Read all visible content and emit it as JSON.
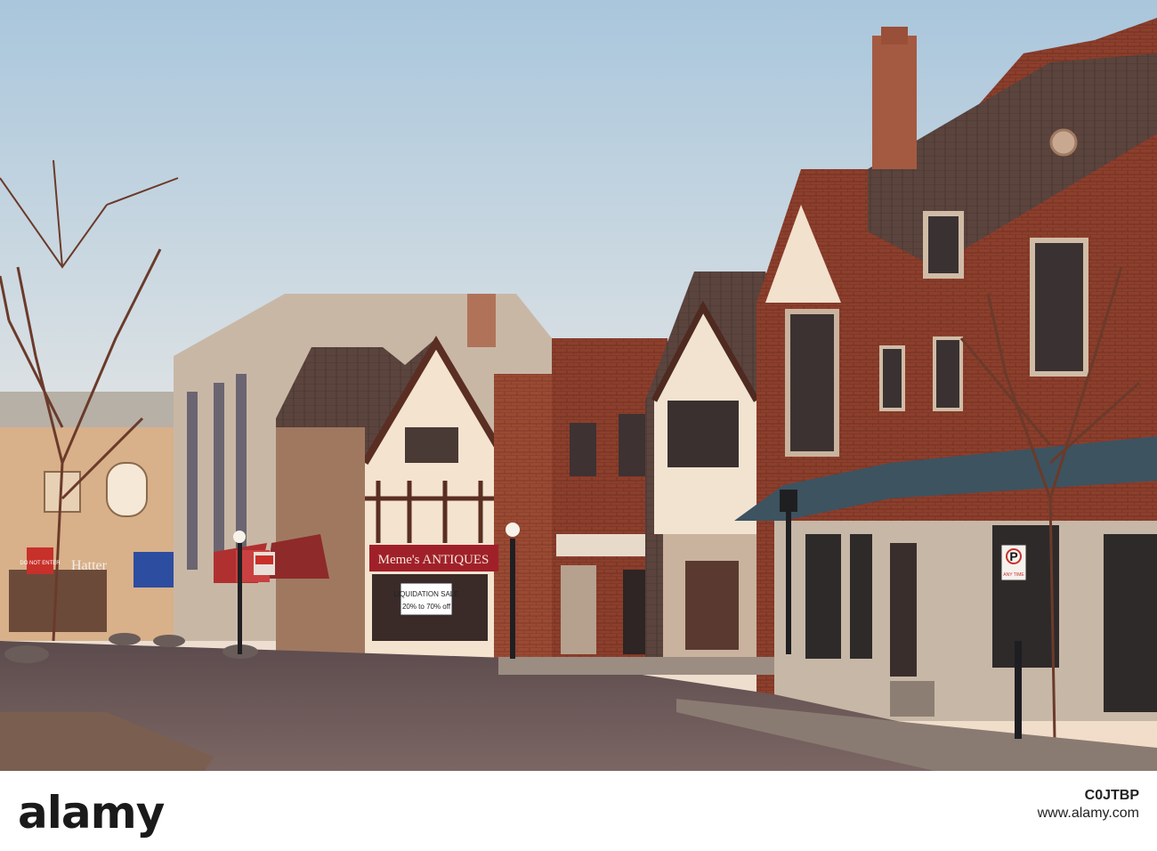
{
  "photo": {
    "description_free": true,
    "signs": {
      "memes": "Meme's ANTIQUES",
      "liquidation": "LIQUIDATION SALE",
      "discount": "20% to 70% off",
      "do_not_enter": "DO NOT ENTER",
      "hatter": "Hatter",
      "no_parking": "P",
      "any_time": "ANY TIME"
    },
    "colors": {
      "sky_top": "#a9c6dc",
      "sky_bottom": "#f5e6d6",
      "brick": "#8a3f2e",
      "street": "#6c5a58",
      "awning": "#a0202a"
    }
  },
  "watermark": {
    "logo": "alamy",
    "image_code": "C0JTBP",
    "site": "www.alamy.com"
  }
}
